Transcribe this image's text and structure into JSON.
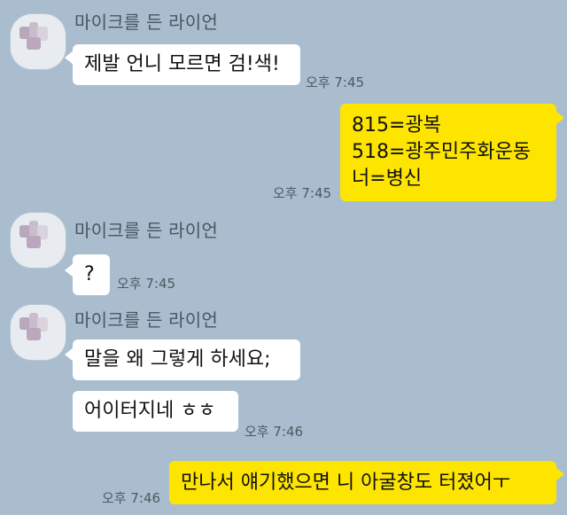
{
  "messages": [
    {
      "sender": "마이크를 든 라이언",
      "text": "제발 언니 모르면 검!색!",
      "time": "오후 7:45"
    },
    {
      "sender": "me",
      "lines": [
        "815=광복",
        "518=광주민주화운동",
        "너=병신"
      ],
      "time": "오후 7:45"
    },
    {
      "sender": "마이크를 든 라이언",
      "text": "?",
      "time": "오후 7:45"
    },
    {
      "sender": "마이크를 든 라이언",
      "text": "말을 왜 그렇게 하세요;",
      "time": ""
    },
    {
      "sender": "마이크를 든 라이언",
      "text": "어이터지네 ㅎㅎ",
      "time": "오후 7:46"
    },
    {
      "sender": "me",
      "text": "만나서 얘기했으면 니 아굴창도 터졌어ㅜ",
      "time": "오후 7:46"
    }
  ],
  "colors": {
    "background": "#a9bdce",
    "incoming_bubble": "#ffffff",
    "outgoing_bubble": "#fee500",
    "sender_text": "#4a5560",
    "time_text": "#4f5961"
  }
}
